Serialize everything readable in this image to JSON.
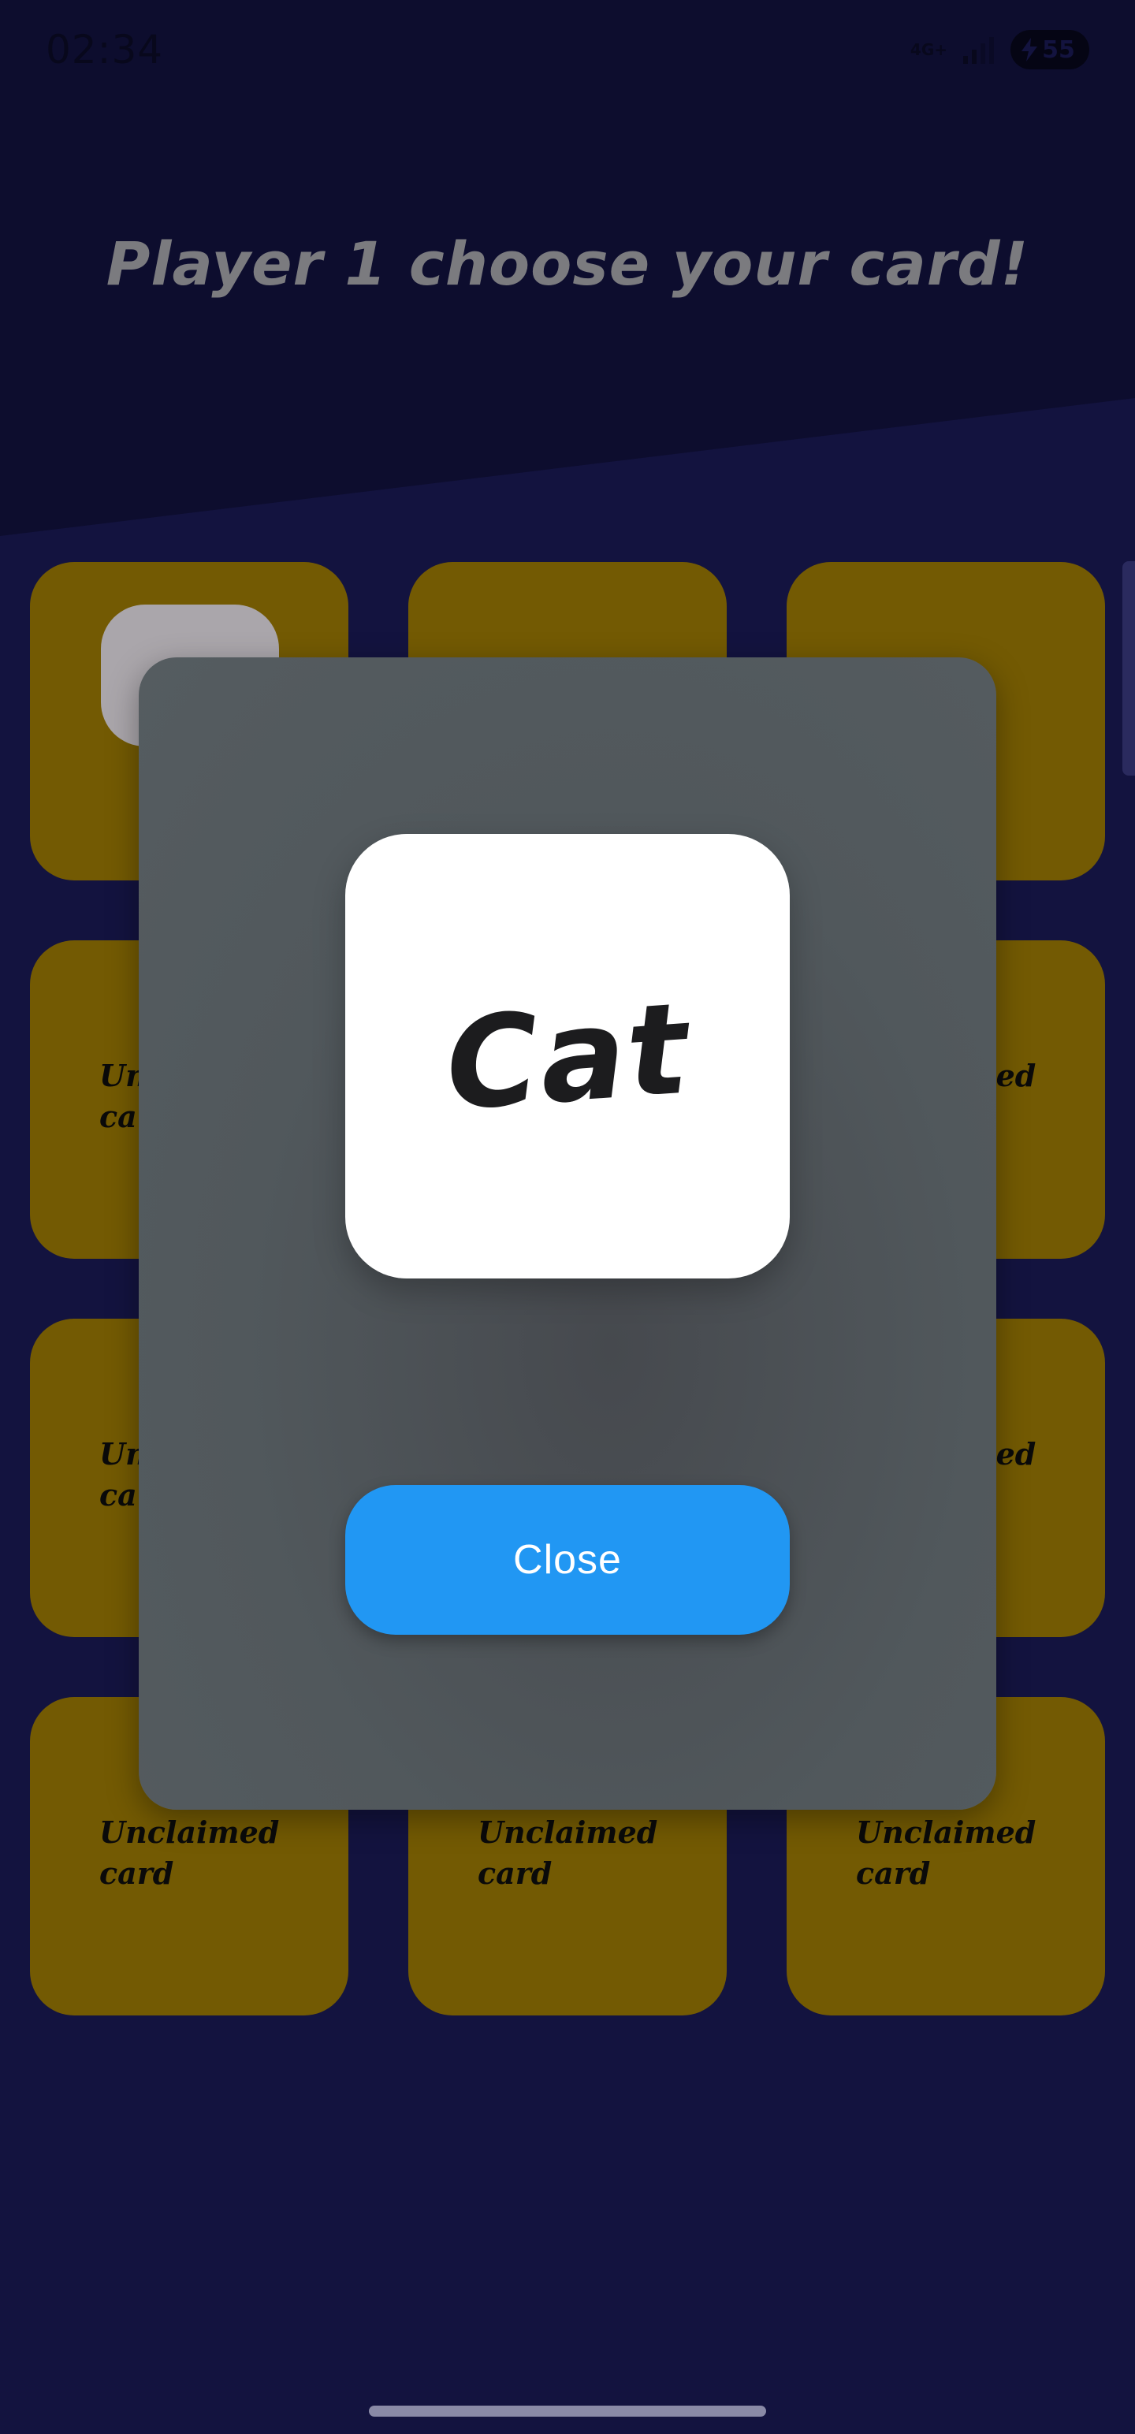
{
  "status_bar": {
    "time": "02:34",
    "network": "4G+",
    "battery": "55"
  },
  "heading": "Player 1 choose your card!",
  "cards": [
    {
      "label": "",
      "claimed": true
    },
    {
      "label": "",
      "claimed": false
    },
    {
      "label": "",
      "claimed": false
    },
    {
      "label": "Unclaimed card",
      "claimed": false
    },
    {
      "label": "",
      "claimed": false
    },
    {
      "label": "Unclaimed card",
      "claimed": false
    },
    {
      "label": "Unclaimed card",
      "claimed": false
    },
    {
      "label": "",
      "claimed": false
    },
    {
      "label": "Unclaimed card",
      "claimed": false
    },
    {
      "label": "Unclaimed card",
      "claimed": false
    },
    {
      "label": "Unclaimed card",
      "claimed": false
    },
    {
      "label": "Unclaimed card",
      "claimed": false
    }
  ],
  "dialog": {
    "word": "Cat",
    "close_label": "Close"
  },
  "colors": {
    "background": "#13133f",
    "top_band": "#0d0d2e",
    "card": "#735a03",
    "dialog": "#51585c",
    "button": "#2197f3"
  }
}
